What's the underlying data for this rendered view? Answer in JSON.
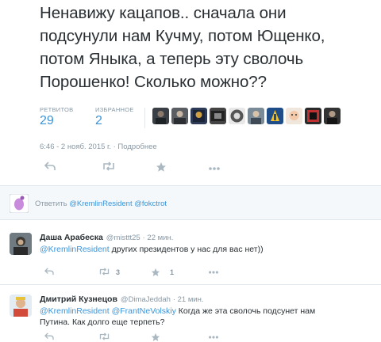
{
  "tweet": {
    "line1": "Ненавижу кацапов.. сначала они",
    "line2": "подсунули нам Кучму, потом Ющенко,",
    "line3": "потом Яныка, а теперь эту сволочь",
    "line4": "Порошенко! Сколько можно??"
  },
  "stats": {
    "retweets_label": "РЕТВИТОВ",
    "retweets_value": "29",
    "favorites_label": "ИЗБРАННОЕ",
    "favorites_value": "2"
  },
  "meta": {
    "time": "6:46 - 2 нояб. 2015 г.",
    "separator": "·",
    "details": "Подробнее"
  },
  "actions": {
    "reply_icon": "reply-arrow-icon",
    "retweet_icon": "retweet-icon",
    "favorite_icon": "star-icon",
    "more_icon": "more-dots-icon"
  },
  "reply_box": {
    "prefix": "Ответить ",
    "mentions": "@KremlinResident @fokctrot"
  },
  "replies": [
    {
      "name": "Даша Арабеска",
      "handle": "@misttt25",
      "time": "· 22 мин.",
      "mentions": "@KremlinResident",
      "text": " других президентов у нас для вас нет))",
      "retweets": "3",
      "favorites": "1"
    },
    {
      "name": "Дмитрий Кузнецов",
      "handle": "@DimaJeddah",
      "time": "· 21 мин.",
      "mentions": "@KremlinResident @FrantNeVolskiy",
      "text_line1": " Когда же эта сволочь подсунет нам",
      "text_line2": "Путина. Как долго еще терпеть?"
    }
  ],
  "colors": {
    "link": "#3b94d9",
    "muted": "#8899a6",
    "text": "#292f33"
  }
}
